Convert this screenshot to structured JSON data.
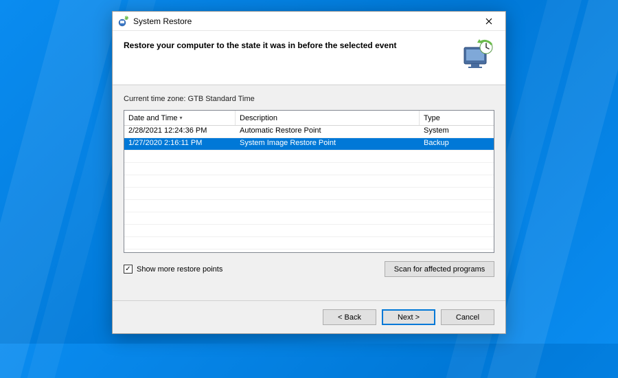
{
  "window": {
    "title": "System Restore"
  },
  "header": {
    "heading": "Restore your computer to the state it was in before the selected event"
  },
  "timezone": {
    "label": "Current time zone: GTB Standard Time"
  },
  "table": {
    "columns": {
      "date": "Date and Time",
      "description": "Description",
      "type": "Type"
    },
    "rows": [
      {
        "date": "2/28/2021 12:24:36 PM",
        "description": "Automatic Restore Point",
        "type": "System",
        "selected": false
      },
      {
        "date": "1/27/2020 2:16:11 PM",
        "description": "System Image Restore Point",
        "type": "Backup",
        "selected": true
      }
    ]
  },
  "showMore": {
    "label": "Show more restore points",
    "checked": true
  },
  "buttons": {
    "scan": "Scan for affected programs",
    "back": "< Back",
    "next": "Next >",
    "cancel": "Cancel"
  }
}
